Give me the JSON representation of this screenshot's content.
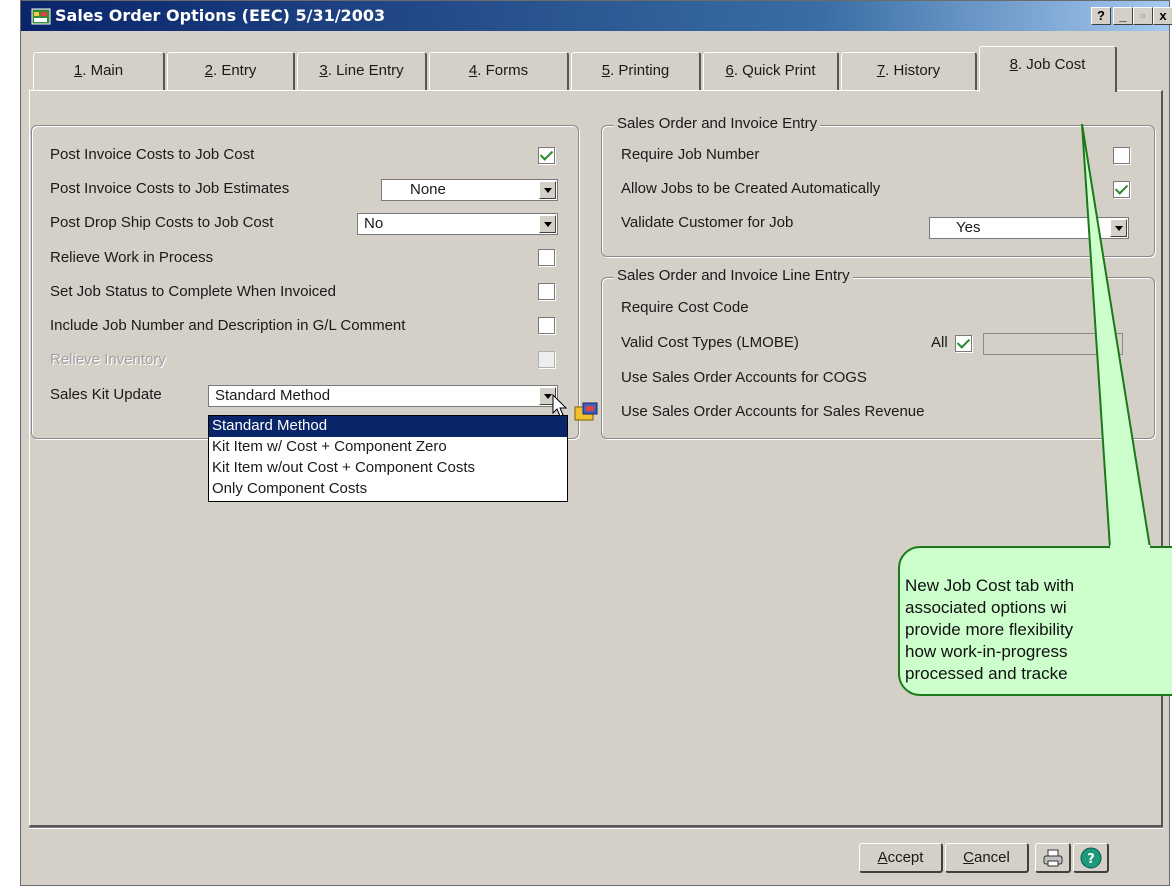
{
  "window": {
    "title": "Sales Order Options (EEC) 5/31/2003",
    "help_btn": "?",
    "min_btn": "_",
    "close_btn": "x"
  },
  "tabs": [
    {
      "num": "1",
      "label": ". Main"
    },
    {
      "num": "2",
      "label": ". Entry"
    },
    {
      "num": "3",
      "label": ". Line Entry"
    },
    {
      "num": "4",
      "label": ". Forms"
    },
    {
      "num": "5",
      "label": ". Printing"
    },
    {
      "num": "6",
      "label": ". Quick Print"
    },
    {
      "num": "7",
      "label": ". History"
    },
    {
      "num": "8",
      "label": ". Job Cost"
    }
  ],
  "left": {
    "post_invoice_costs": {
      "label": "Post Invoice Costs to Job Cost",
      "checked": true
    },
    "post_estimates": {
      "label": "Post Invoice Costs to Job Estimates",
      "value": "None"
    },
    "post_drop_ship": {
      "label": "Post Drop Ship Costs to Job Cost",
      "value": "No"
    },
    "relieve_wip": {
      "label": "Relieve Work in Process",
      "checked": false
    },
    "set_job_status": {
      "label": "Set Job Status to Complete When Invoiced",
      "checked": false
    },
    "include_job_number": {
      "label": "Include Job Number and Description in G/L Comment",
      "checked": false
    },
    "relieve_inventory": {
      "label": "Relieve Inventory",
      "checked": false,
      "disabled": true
    },
    "sales_kit": {
      "label": "Sales Kit Update",
      "value": "Standard Method"
    }
  },
  "sales_kit_options": [
    "Standard Method",
    "Kit Item w/ Cost + Component Zero",
    "Kit Item w/out Cost + Component Costs",
    "Only Component Costs"
  ],
  "so_entry": {
    "title": "Sales Order and Invoice Entry",
    "require_job": {
      "label": "Require Job Number",
      "checked": false
    },
    "allow_jobs": {
      "label": "Allow Jobs to be Created Automatically",
      "checked": true
    },
    "validate_customer": {
      "label": "Validate Customer for Job",
      "value": "Yes"
    }
  },
  "line_entry": {
    "title": "Sales Order and Invoice Line Entry",
    "require_cost_code": "Require Cost Code",
    "valid_cost_types": "Valid Cost Types (LMOBE)",
    "all_label": "All",
    "all_checked": true,
    "cogs": "Use Sales Order Accounts for COGS",
    "revenue": "Use Sales Order Accounts for Sales Revenue"
  },
  "buttons": {
    "accept": {
      "u": "A",
      "rest": "ccept"
    },
    "cancel": {
      "u": "C",
      "rest": "ancel"
    }
  },
  "callout": {
    "lines": [
      "New Job Cost tab with",
      "associated options wi",
      "provide more flexibility",
      "how work-in-progress",
      "processed and tracke"
    ]
  },
  "colors": {
    "titlebar": "#0a246a",
    "dialog": "#d4d0c8",
    "selection": "#0a246a",
    "callout_fill": "#ccffcc",
    "callout_border": "#1a7a1a",
    "check": "#2a8a2a"
  }
}
